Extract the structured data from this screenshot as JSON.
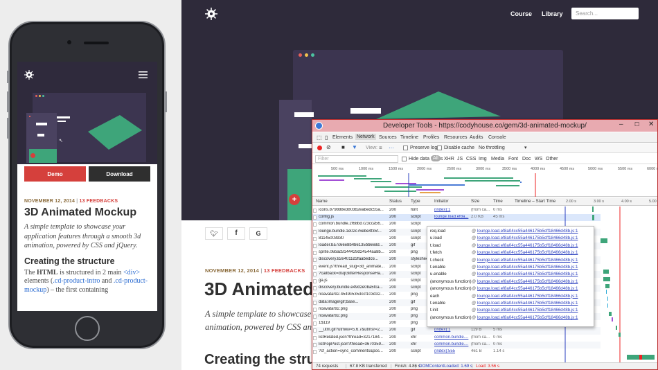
{
  "phone": {
    "demo_label": "Demo",
    "download_label": "Download",
    "date": "NOVEMBER 12, 2014",
    "sep": "|",
    "feedback": "13 FEEDBACKS",
    "title": "3D Animated Mockup",
    "intro": "A simple template to showcase your application features through a smooth 3d animation, powered by CSS and jQuery.",
    "section_title": "Creating the structure",
    "body_p1": "The ",
    "body_html": "HTML",
    "body_p2": " is structured in 2 main ",
    "body_div": "<div>",
    "body_p3": " elements (",
    "body_class1": ".cd-product-intro",
    "body_p4": " and ",
    "body_class2": ".cd-product-mockup",
    "body_p5": ") – the first containing"
  },
  "site": {
    "nav": {
      "course": "Course",
      "library": "Library",
      "search_placeholder": "Search..."
    },
    "date": "NOVEMBER 12, 2014",
    "sep": "|",
    "feedback": "13 FEEDBACKS",
    "title": "3D Animated",
    "intro_line1": "A simple template to showcase",
    "intro_line2": "animation, powered by CSS and",
    "section_title": "Creating the stru",
    "plus": "+"
  },
  "devtools": {
    "title": "Developer Tools - https://codyhouse.co/gem/3d-animated-mockup/",
    "tabs": [
      "Elements",
      "Network",
      "Sources",
      "Timeline",
      "Profiles",
      "Resources",
      "Audits",
      "Console"
    ],
    "active_tab": "Network",
    "view_label": "View:",
    "preserve_log": "Preserve log",
    "disable_cache": "Disable cache",
    "throttle": "No throttling",
    "filter_placeholder": "Filter",
    "hide_data_urls": "Hide data URLs",
    "filter_types": [
      "All",
      "XHR",
      "JS",
      "CSS",
      "Img",
      "Media",
      "Font",
      "Doc",
      "WS",
      "Other"
    ],
    "overview_ticks": [
      "500 ms",
      "1000 ms",
      "1500 ms",
      "2000 ms",
      "2500 ms",
      "3000 ms",
      "3500 ms",
      "4000 ms",
      "4500 ms",
      "5000 ms",
      "5500 ms",
      "6000 ms"
    ],
    "columns": [
      "Name",
      "Status",
      "Type",
      "Initiator",
      "Size",
      "Time",
      "Timeline – Start Time"
    ],
    "waterfall_ticks": [
      "2.00 s",
      "3.00 s",
      "4.00 s",
      "5.00 s"
    ],
    "rows": [
      {
        "name": "icons.879888e3803b2eabedc55a...",
        "status": "200",
        "type": "font",
        "initiator": "(index):1",
        "size": "(from ca...",
        "time": "0 ms"
      },
      {
        "name": "config.js",
        "status": "200",
        "type": "script",
        "initiator": "lounge.load.ef8a...",
        "size": "2.0 KB",
        "time": "45 ms"
      },
      {
        "name": "common.bundle.2f68bd723cca56...",
        "status": "200",
        "type": "script",
        "initiator": "",
        "size": "",
        "time": ""
      },
      {
        "name": "lounge.bundle.1e02c76ebe4f35f...",
        "status": "200",
        "type": "script",
        "initiator": "",
        "size": "",
        "time": ""
      },
      {
        "name": "81145003930",
        "status": "200",
        "type": "script",
        "initiator": "",
        "size": "",
        "time": ""
      },
      {
        "name": "loader.ba7c66e8b4b6135bb668d...",
        "status": "200",
        "type": "gif",
        "initiator": "",
        "size": "",
        "time": ""
      },
      {
        "name": "sprite.06bad3144429d24544aa8b...",
        "status": "200",
        "type": "png",
        "initiator": "",
        "size": "",
        "time": ""
      },
      {
        "name": "discovery.82e4011d3faabedc6...",
        "status": "200",
        "type": "stylesheet",
        "initiator": "",
        "size": "",
        "time": ""
      },
      {
        "name": "event.js?thread_slug=3d_animate...",
        "status": "200",
        "type": "script",
        "initiator": "",
        "size": "",
        "time": ""
      },
      {
        "name": "?callback=dsqGlitterResponseHa...",
        "status": "200",
        "type": "script",
        "initiator": "",
        "size": "",
        "time": ""
      },
      {
        "name": "ga.js",
        "status": "200",
        "type": "script",
        "initiator": "",
        "size": "",
        "time": ""
      },
      {
        "name": "discovery.bundle.e49d2e0ba5fca...",
        "status": "200",
        "type": "script",
        "initiator": "",
        "size": "",
        "time": ""
      },
      {
        "name": "noavatar92.4549c5353ccf103d32...",
        "status": "200",
        "type": "png",
        "initiator": "",
        "size": "",
        "time": ""
      },
      {
        "name": "data:image/gif;base...",
        "status": "200",
        "type": "gif",
        "initiator": "",
        "size": "",
        "time": ""
      },
      {
        "name": "noavatar92.png",
        "status": "200",
        "type": "png",
        "initiator": "",
        "size": "",
        "time": ""
      },
      {
        "name": "noavatar92.png",
        "status": "200",
        "type": "png",
        "initiator": "",
        "size": "",
        "time": ""
      },
      {
        "name": "1$119",
        "status": "200",
        "type": "png",
        "initiator": "",
        "size": "",
        "time": ""
      },
      {
        "name": "__utm.gif?utmwv=5.6.7&utmsr=2...",
        "status": "200",
        "type": "gif",
        "initiator": "(index):1",
        "size": "119 B",
        "time": "5 ms"
      },
      {
        "name": "listRelated.json?thread=3217184...",
        "status": "200",
        "type": "xhr",
        "initiator": "common.bundle....",
        "size": "(from ca...",
        "time": "0 ms"
      },
      {
        "name": "listPopPost.json?thread=3670359...",
        "status": "200",
        "type": "xhr",
        "initiator": "common.bundle....",
        "size": "(from ca...",
        "time": "0 ms"
      },
      {
        "name": "?cf_action=sync_comments&pos...",
        "status": "200",
        "type": "script",
        "initiator": "(index):555",
        "size": "461 B",
        "time": "1.14 s"
      }
    ],
    "status_bar": "74 requests | 67.8 KB transferred | Finish: 4.86 s | DOMContentLoaded: 1.69 s | Load: 3.56 s",
    "status_parts": {
      "req": "74 requests",
      "kb": "67.8 KB transferred",
      "finish": "Finish: 4.86 s",
      "dcl": "DOMContentLoaded: 1.69 s",
      "load": "Load: 3.56 s"
    },
    "popup": [
      {
        "fn": "req.load",
        "src": "lounge.load.ef8a04cc55a446175b5cff18466d48b.js:1"
      },
      {
        "fn": "u.load",
        "src": "lounge.load.ef8a04cc55a446175b5cff18466d48b.js:1"
      },
      {
        "fn": "t.load",
        "src": "lounge.load.ef8a04cc55a446175b5cff18466d48b.js:1"
      },
      {
        "fn": "t.fetch",
        "src": "lounge.load.ef8a04cc55a446175b5cff18466d48b.js:1"
      },
      {
        "fn": "t.check",
        "src": "lounge.load.ef8a04cc55a446175b5cff18466d48b.js:1"
      },
      {
        "fn": "t.enable",
        "src": "lounge.load.ef8a04cc55a446175b5cff18466d48b.js:1"
      },
      {
        "fn": "u.enable",
        "src": "lounge.load.ef8a04cc55a446175b5cff18466d48b.js:1"
      },
      {
        "fn": "(anonymous function)",
        "src": "lounge.load.ef8a04cc55a446175b5cff18466d48b.js:1"
      },
      {
        "fn": "(anonymous function)",
        "src": "lounge.load.ef8a04cc55a446175b5cff18466d48b.js:1"
      },
      {
        "fn": "each",
        "src": "lounge.load.ef8a04cc55a446175b5cff18466d48b.js:1"
      },
      {
        "fn": "t.enable",
        "src": "lounge.load.ef8a04cc55a446175b5cff18466d48b.js:1"
      },
      {
        "fn": "t.init",
        "src": "lounge.load.ef8a04cc55a446175b5cff18466d48b.js:1"
      },
      {
        "fn": "(anonymous function)",
        "src": "lounge.load.ef8a04cc55a446175b5cff18466d48b.js:1"
      }
    ]
  },
  "colors": {
    "brand_red": "#d5403c",
    "dark_bg": "#2e2a3a",
    "green": "#3ea57a",
    "link_blue": "#2a3fbf"
  }
}
